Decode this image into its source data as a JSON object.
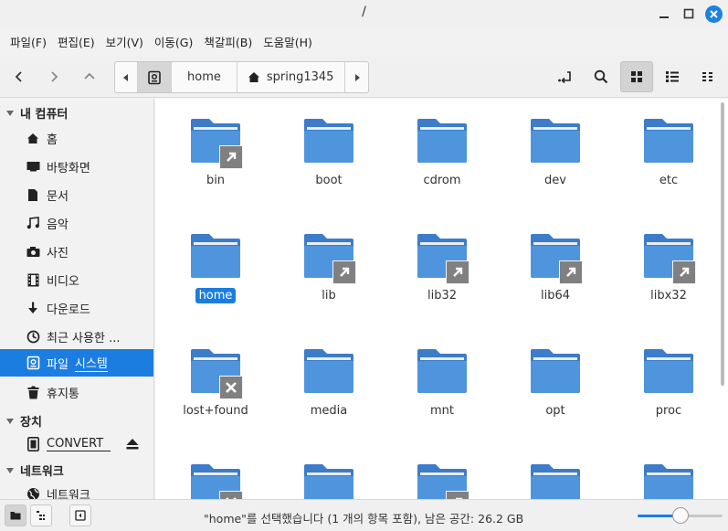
{
  "window": {
    "title": "/"
  },
  "colors": {
    "accent": "#1c7de0",
    "folder": "#4a90d9",
    "emblem": "#808080"
  },
  "menu": [
    "파일(F)",
    "편집(E)",
    "보기(V)",
    "이동(G)",
    "책갈피(B)",
    "도움말(H)"
  ],
  "toolbar": {
    "back_icon": "chevron-left-icon",
    "forward_icon": "chevron-right-icon",
    "up_icon": "chevron-up-icon",
    "path": {
      "crumb1": "home",
      "crumb2": "spring1345"
    },
    "right_icons": [
      "open-terminal-icon",
      "search-icon",
      "grid-view-icon",
      "list-view-icon",
      "compact-view-icon"
    ],
    "active_view": "grid"
  },
  "sidebar": {
    "sections": {
      "computer": "내 컴퓨터",
      "devices": "장치",
      "network": "네트워크"
    },
    "items": [
      {
        "label": "홈",
        "icon": "home-icon"
      },
      {
        "label": "바탕화면",
        "icon": "desktop-icon"
      },
      {
        "label": "문서",
        "icon": "document-icon"
      },
      {
        "label": "음악",
        "icon": "music-icon"
      },
      {
        "label": "사진",
        "icon": "camera-icon"
      },
      {
        "label": "비디오",
        "icon": "video-icon"
      },
      {
        "label": "다운로드",
        "icon": "download-icon"
      },
      {
        "label": "최근 사용한 ...",
        "icon": "recent-icon"
      },
      {
        "label_a": "파일",
        "label_b": "시스템",
        "icon": "filesystem-icon",
        "selected": true
      },
      {
        "label": "휴지통",
        "icon": "trash-icon"
      }
    ],
    "devices": [
      {
        "label": "CONVERT",
        "icon": "drive-icon"
      }
    ],
    "network": [
      {
        "label": "네트워크",
        "icon": "network-icon"
      }
    ]
  },
  "files": [
    {
      "name": "bin",
      "emblem": "link"
    },
    {
      "name": "boot",
      "emblem": ""
    },
    {
      "name": "cdrom",
      "emblem": ""
    },
    {
      "name": "dev",
      "emblem": ""
    },
    {
      "name": "etc",
      "emblem": ""
    },
    {
      "name": "home",
      "emblem": "",
      "selected": true
    },
    {
      "name": "lib",
      "emblem": "link"
    },
    {
      "name": "lib32",
      "emblem": "link"
    },
    {
      "name": "lib64",
      "emblem": "link"
    },
    {
      "name": "libx32",
      "emblem": "link"
    },
    {
      "name": "lost+found",
      "emblem": "unreadable"
    },
    {
      "name": "media",
      "emblem": ""
    },
    {
      "name": "mnt",
      "emblem": ""
    },
    {
      "name": "opt",
      "emblem": ""
    },
    {
      "name": "proc",
      "emblem": ""
    },
    {
      "name": "",
      "emblem": "unreadable"
    },
    {
      "name": "",
      "emblem": ""
    },
    {
      "name": "",
      "emblem": "link"
    },
    {
      "name": "",
      "emblem": ""
    },
    {
      "name": "",
      "emblem": ""
    }
  ],
  "statusbar": {
    "text": "\"home\"를 선택했습니다 (1 개의 항목 포함), 남은 공간: 26.2 GB",
    "zoom_fraction": 0.5
  }
}
